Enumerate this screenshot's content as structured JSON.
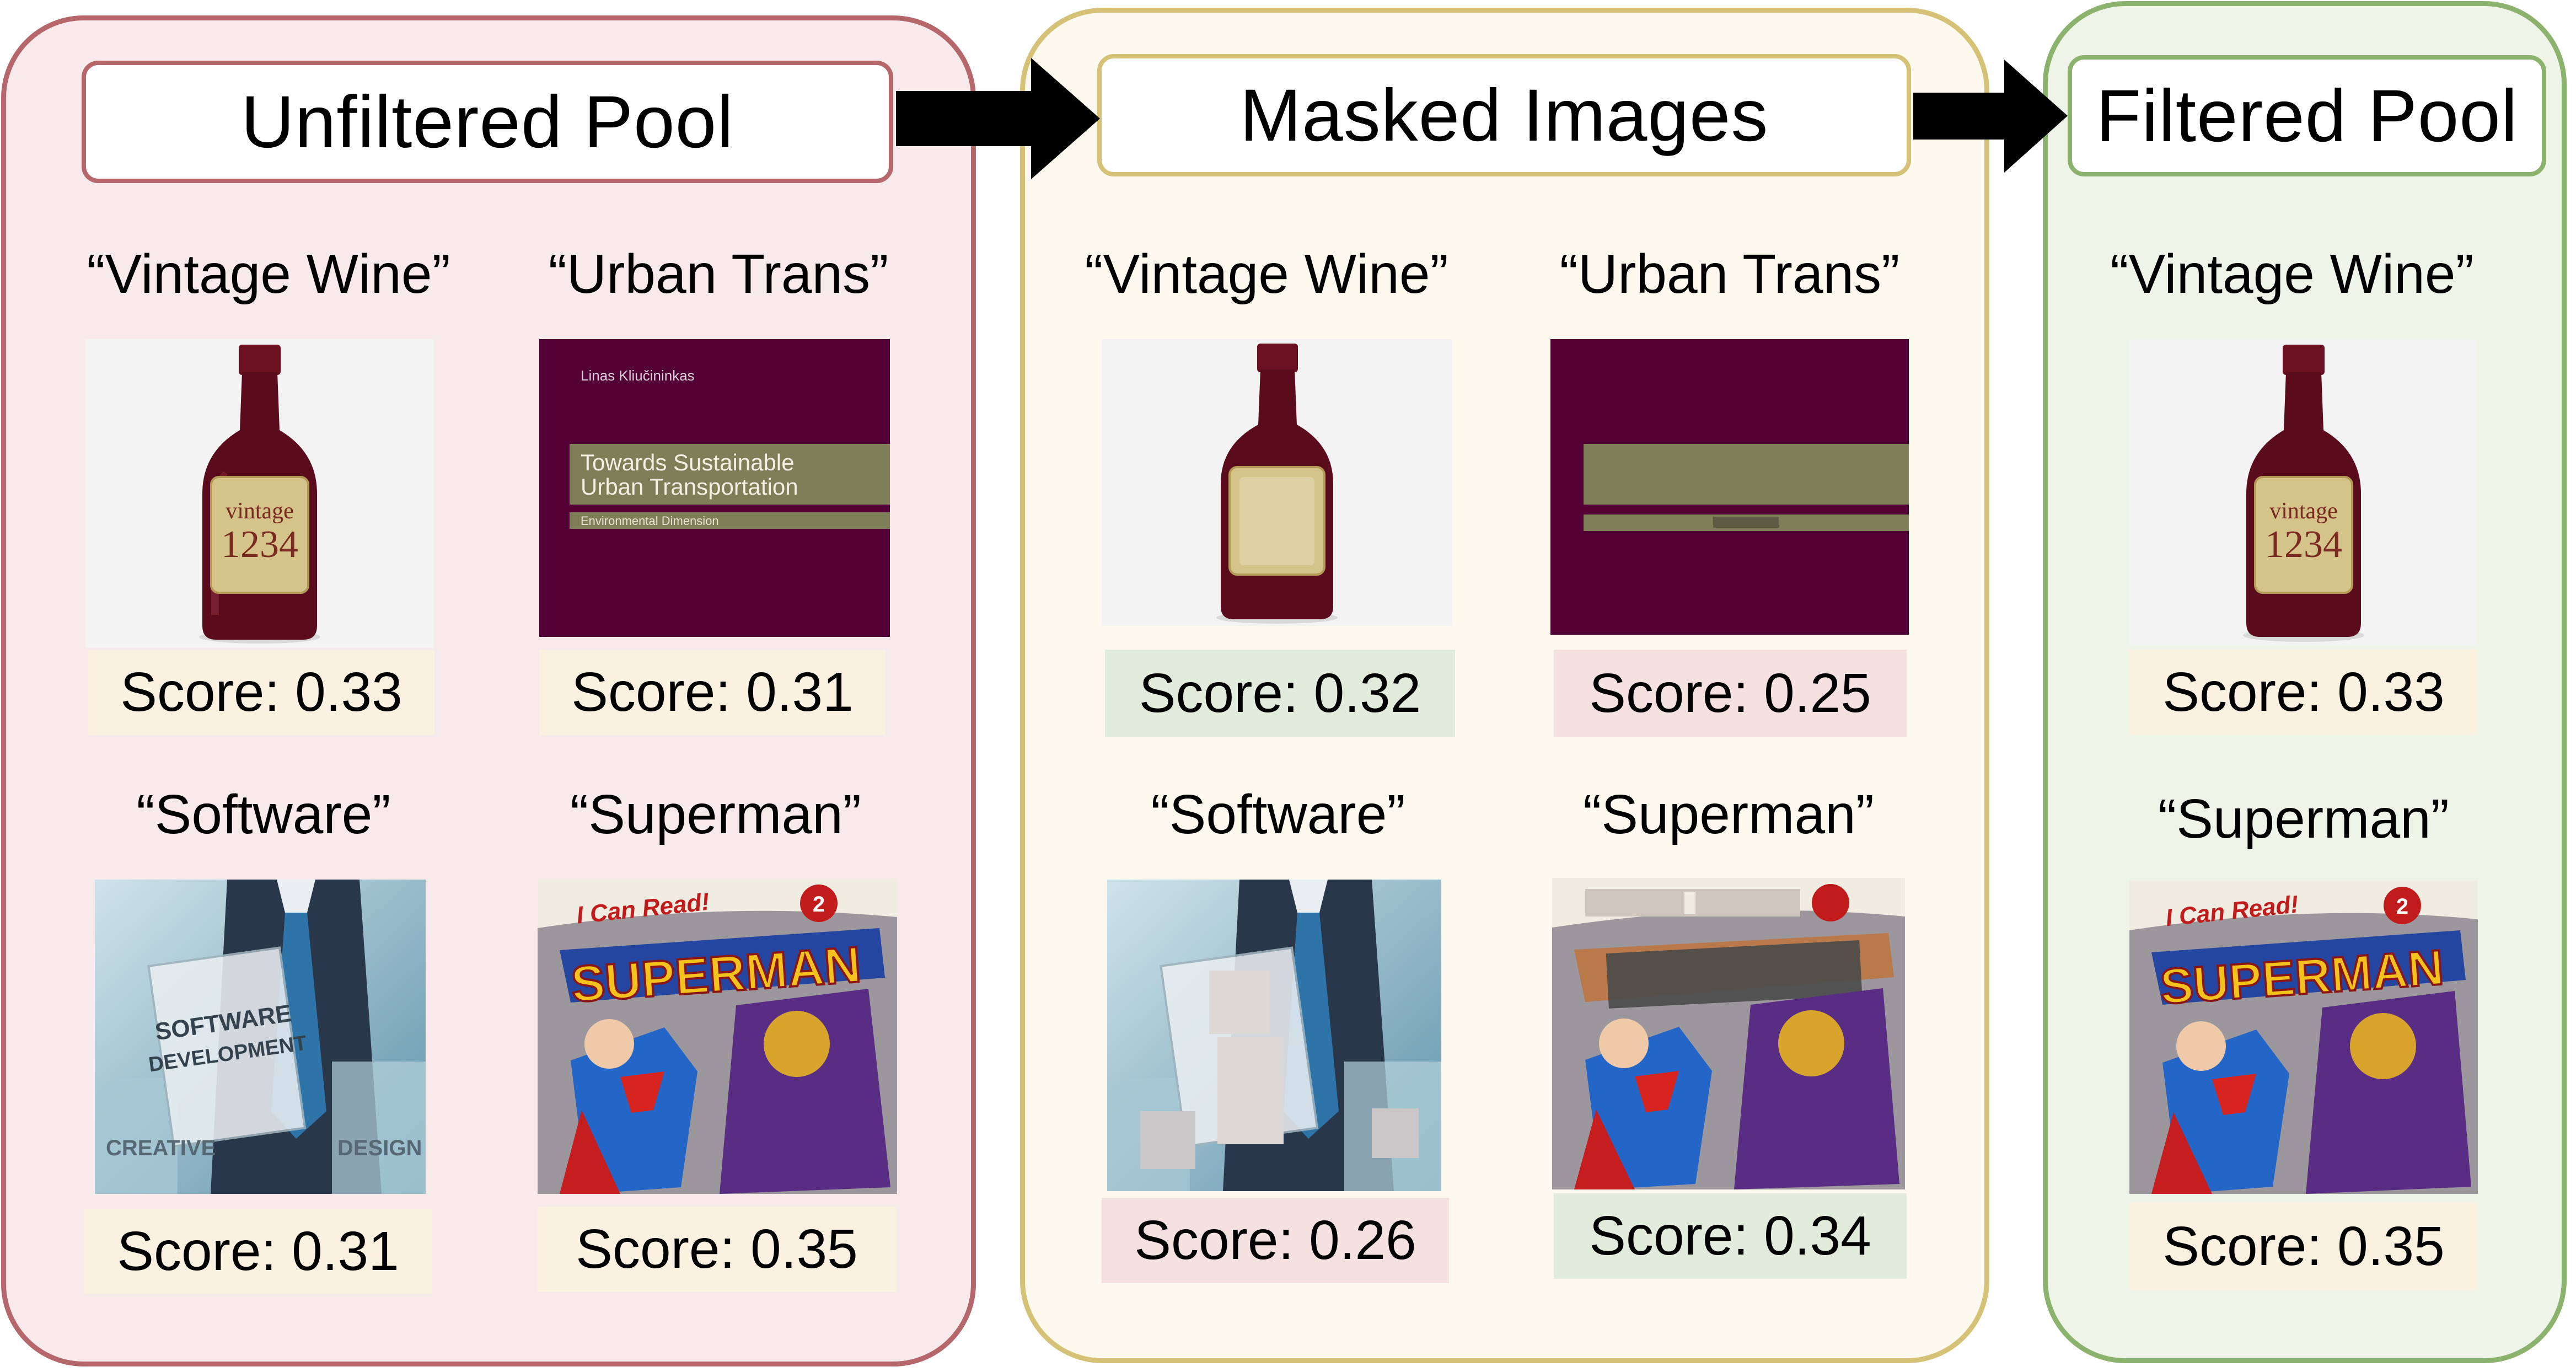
{
  "colors": {
    "unfiltered_bg": "#f8e9ea",
    "unfiltered_border": "#b5676b",
    "masked_bg": "#fdf9ee",
    "masked_border": "#d6c277",
    "filtered_bg": "#eef4e8",
    "filtered_border": "#8cb36e",
    "score_neutral": "#fbf1e1",
    "score_up": "#e2ecdd",
    "score_down": "#f5e1df",
    "wine": "#5a0b1c",
    "cover_purple": "#530037",
    "mask_gray": "#dcd8d6",
    "mask_olive": "#7e7f58"
  },
  "panels": [
    {
      "title": "Unfiltered Pool"
    },
    {
      "title": "Masked Images"
    },
    {
      "title": "Filtered Pool"
    }
  ],
  "items": {
    "u_wine": {
      "caption": "“Vintage Wine”",
      "score": "Score: 0.33"
    },
    "u_urban": {
      "caption": "“Urban Trans”",
      "score": "Score: 0.31"
    },
    "u_software": {
      "caption": "“Software”",
      "score": "Score: 0.31"
    },
    "u_superman": {
      "caption": "“Superman”",
      "score": "Score: 0.35"
    },
    "m_wine": {
      "caption": "“Vintage Wine”",
      "score": "Score: 0.32"
    },
    "m_urban": {
      "caption": "“Urban Trans”",
      "score": "Score: 0.25"
    },
    "m_software": {
      "caption": "“Software”",
      "score": "Score: 0.26"
    },
    "m_superman": {
      "caption": "“Superman”",
      "score": "Score: 0.34"
    },
    "f_wine": {
      "caption": "“Vintage Wine”",
      "score": "Score: 0.33"
    },
    "f_superman": {
      "caption": "“Superman”",
      "score": "Score: 0.35"
    }
  },
  "image_text": {
    "wine_label_1": "vintage",
    "wine_label_2": "1234",
    "book_author": "Linas Kliučininkas",
    "book_title_1": "Towards Sustainable",
    "book_title_2": "Urban Transportation",
    "book_subtitle": "Environmental Dimension",
    "software_1": "SOFTWARE",
    "software_2": "DEVELOPMENT",
    "software_creative": "CREATIVE",
    "software_design": "DESIGN",
    "comic_series": "I Can Read!",
    "comic_level": "2",
    "comic_title": "SUPERMAN"
  }
}
